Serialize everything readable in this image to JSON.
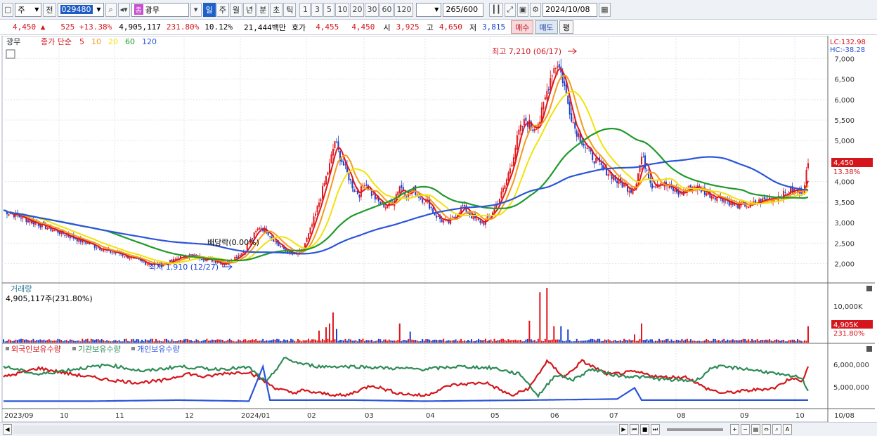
{
  "toolbar": {
    "market": "주",
    "prev": "전",
    "code": "029480",
    "badge": "종",
    "name": "광무",
    "periods": [
      "일",
      "주",
      "월",
      "년",
      "분",
      "초",
      "틱"
    ],
    "active_period": "일",
    "intervals": [
      "1",
      "3",
      "5",
      "10",
      "20",
      "30",
      "60",
      "120"
    ],
    "count": "265",
    "count_max": "/600",
    "date": "2024/10/08"
  },
  "quote": {
    "price": "4,450",
    "change_mark": "▲",
    "change": "525",
    "pct": "+13.38%",
    "volume": "4,905,117",
    "vol_ratio": "231.80%",
    "turnover": "10.12%",
    "amount": "21,444백만",
    "hoga_label": "호가",
    "bid": "4,455",
    "ask": "4,450",
    "open_label": "시",
    "open": "3,925",
    "high_label": "고",
    "high": "4,650",
    "low_label": "저",
    "low": "3,815",
    "buy": "매수",
    "sell": "매도",
    "eval": "평"
  },
  "legend": {
    "name": "광무",
    "ma_label": "종가 단순",
    "ma": [
      {
        "p": "5",
        "c": "#e0161c"
      },
      {
        "p": "10",
        "c": "#f59a1b"
      },
      {
        "p": "20",
        "c": "#f2e20a"
      },
      {
        "p": "60",
        "c": "#1e9a2a"
      },
      {
        "p": "120",
        "c": "#2a55d9"
      }
    ]
  },
  "lchc": {
    "lc": "LC:132.98",
    "hc": "HC:-38.28"
  },
  "annotations": {
    "high": "최고 7,210 (06/17)",
    "low": "최저 1,910 (12/27)",
    "dividend": "배당락(0.00%)"
  },
  "price_tag": {
    "value": "4,450",
    "pct": "13.38%"
  },
  "volume_panel": {
    "title": "거래량",
    "value": "4,905,117주(231.80%)",
    "axis": "10,000K",
    "tag": "4,905K",
    "tag_pct": "231.80%"
  },
  "holdings_panel": {
    "labels": [
      "외국인보유수량",
      "기관보유수량",
      "개인보유수량"
    ],
    "colors": [
      "#d4161c",
      "#2e8b57",
      "#2a55d9"
    ],
    "axis": [
      "6,000,000",
      "5,000,000"
    ]
  },
  "x_labels": [
    "2023/09",
    "10",
    "11",
    "12",
    "2024/01",
    "02",
    "03",
    "04",
    "05",
    "06",
    "07",
    "08",
    "09",
    "10",
    "10/08"
  ],
  "chart_data": {
    "type": "candlestick",
    "y_ticks": [
      7000,
      6500,
      6000,
      5500,
      5000,
      4500,
      4000,
      3500,
      3000,
      2500,
      2000
    ],
    "ylim": [
      1650,
      7450
    ],
    "high_point": {
      "value": 7210,
      "date": "06/17"
    },
    "low_point": {
      "value": 1910,
      "date": "12/27"
    },
    "last_close": 4450,
    "price_path": [
      [
        0,
        3300
      ],
      [
        6,
        3200
      ],
      [
        12,
        3100
      ],
      [
        18,
        3000
      ],
      [
        24,
        2900
      ],
      [
        30,
        2800
      ],
      [
        36,
        2700
      ],
      [
        42,
        2600
      ],
      [
        48,
        2500
      ],
      [
        54,
        2400
      ],
      [
        60,
        2300
      ],
      [
        66,
        2250
      ],
      [
        72,
        2150
      ],
      [
        78,
        2050
      ],
      [
        84,
        2000
      ],
      [
        90,
        1980
      ],
      [
        96,
        2050
      ],
      [
        100,
        2150
      ],
      [
        106,
        2200
      ],
      [
        112,
        2150
      ],
      [
        118,
        2100
      ],
      [
        122,
        2050
      ],
      [
        126,
        2000
      ],
      [
        132,
        2150
      ],
      [
        137,
        2300
      ],
      [
        140,
        2500
      ],
      [
        143,
        2700
      ],
      [
        146,
        2900
      ],
      [
        150,
        2800
      ],
      [
        154,
        2600
      ],
      [
        158,
        2400
      ],
      [
        162,
        2300
      ],
      [
        166,
        2200
      ],
      [
        170,
        2300
      ],
      [
        174,
        2700
      ],
      [
        178,
        3200
      ],
      [
        182,
        3800
      ],
      [
        186,
        4400
      ],
      [
        189,
        5000
      ],
      [
        192,
        4600
      ],
      [
        196,
        4200
      ],
      [
        200,
        3800
      ],
      [
        203,
        3700
      ],
      [
        206,
        4000
      ],
      [
        210,
        3700
      ],
      [
        214,
        3500
      ],
      [
        218,
        3400
      ],
      [
        222,
        3500
      ],
      [
        226,
        3900
      ],
      [
        230,
        3700
      ],
      [
        234,
        3800
      ],
      [
        238,
        3600
      ],
      [
        242,
        3500
      ],
      [
        246,
        3200
      ],
      [
        250,
        3050
      ],
      [
        254,
        3000
      ],
      [
        258,
        3200
      ],
      [
        262,
        3400
      ],
      [
        266,
        3200
      ],
      [
        270,
        3050
      ],
      [
        274,
        3000
      ],
      [
        278,
        3200
      ],
      [
        282,
        3500
      ],
      [
        286,
        3900
      ],
      [
        290,
        4500
      ],
      [
        294,
        5200
      ],
      [
        298,
        5500
      ],
      [
        302,
        5300
      ],
      [
        306,
        5500
      ],
      [
        310,
        6200
      ],
      [
        313,
        6700
      ],
      [
        316,
        6900
      ],
      [
        319,
        6500
      ],
      [
        322,
        5900
      ],
      [
        326,
        5300
      ],
      [
        330,
        5000
      ],
      [
        334,
        4700
      ],
      [
        338,
        4500
      ],
      [
        342,
        4300
      ],
      [
        346,
        4200
      ],
      [
        350,
        4000
      ],
      [
        354,
        3900
      ],
      [
        358,
        3800
      ],
      [
        361,
        4000
      ],
      [
        364,
        4600
      ],
      [
        367,
        4300
      ],
      [
        370,
        3900
      ],
      [
        374,
        4000
      ],
      [
        378,
        3900
      ],
      [
        382,
        3800
      ],
      [
        386,
        3700
      ],
      [
        390,
        3800
      ],
      [
        394,
        3900
      ],
      [
        398,
        3800
      ],
      [
        402,
        3700
      ],
      [
        406,
        3650
      ],
      [
        410,
        3600
      ],
      [
        414,
        3500
      ],
      [
        418,
        3400
      ],
      [
        422,
        3450
      ],
      [
        426,
        3400
      ],
      [
        430,
        3500
      ],
      [
        434,
        3550
      ],
      [
        438,
        3600
      ],
      [
        442,
        3650
      ],
      [
        446,
        3700
      ],
      [
        450,
        3800
      ],
      [
        453,
        3750
      ],
      [
        456,
        3800
      ],
      [
        459,
        4450
      ]
    ],
    "volume_spikes": [
      [
        180,
        22
      ],
      [
        184,
        28
      ],
      [
        186,
        35
      ],
      [
        188,
        55
      ],
      [
        190,
        25
      ],
      [
        226,
        35
      ],
      [
        232,
        20
      ],
      [
        300,
        40
      ],
      [
        306,
        92
      ],
      [
        310,
        100
      ],
      [
        314,
        30
      ],
      [
        318,
        30
      ],
      [
        322,
        24
      ],
      [
        360,
        15
      ],
      [
        364,
        35
      ],
      [
        459,
        30
      ]
    ],
    "holdings": {
      "foreign": [
        [
          0,
          0.55
        ],
        [
          20,
          0.72
        ],
        [
          40,
          0.6
        ],
        [
          60,
          0.5
        ],
        [
          75,
          0.45
        ],
        [
          90,
          0.48
        ],
        [
          105,
          0.62
        ],
        [
          115,
          0.55
        ],
        [
          125,
          0.62
        ],
        [
          140,
          0.65
        ],
        [
          155,
          0.35
        ],
        [
          165,
          0.25
        ],
        [
          170,
          0.3
        ],
        [
          180,
          0.25
        ],
        [
          195,
          0.2
        ],
        [
          210,
          0.4
        ],
        [
          225,
          0.25
        ],
        [
          240,
          0.2
        ],
        [
          255,
          0.4
        ],
        [
          275,
          0.45
        ],
        [
          290,
          0.2
        ],
        [
          300,
          0.35
        ],
        [
          310,
          0.85
        ],
        [
          320,
          0.55
        ],
        [
          330,
          0.85
        ],
        [
          345,
          0.6
        ],
        [
          360,
          0.65
        ],
        [
          375,
          0.55
        ],
        [
          390,
          0.55
        ],
        [
          400,
          0.35
        ],
        [
          410,
          0.25
        ],
        [
          425,
          0.3
        ],
        [
          440,
          0.35
        ],
        [
          450,
          0.55
        ],
        [
          455,
          0.45
        ],
        [
          459,
          0.75
        ]
      ],
      "institution": [
        [
          0,
          0.75
        ],
        [
          20,
          0.6
        ],
        [
          40,
          0.7
        ],
        [
          60,
          0.78
        ],
        [
          80,
          0.66
        ],
        [
          100,
          0.75
        ],
        [
          120,
          0.7
        ],
        [
          140,
          0.73
        ],
        [
          150,
          0.45
        ],
        [
          160,
          0.9
        ],
        [
          170,
          0.8
        ],
        [
          180,
          0.75
        ],
        [
          200,
          0.75
        ],
        [
          220,
          0.72
        ],
        [
          240,
          0.7
        ],
        [
          260,
          0.75
        ],
        [
          280,
          0.72
        ],
        [
          295,
          0.6
        ],
        [
          305,
          0.2
        ],
        [
          315,
          0.6
        ],
        [
          325,
          0.5
        ],
        [
          335,
          0.7
        ],
        [
          350,
          0.58
        ],
        [
          365,
          0.55
        ],
        [
          380,
          0.5
        ],
        [
          395,
          0.48
        ],
        [
          405,
          0.75
        ],
        [
          420,
          0.72
        ],
        [
          435,
          0.65
        ],
        [
          445,
          0.58
        ],
        [
          455,
          0.55
        ],
        [
          459,
          0.3
        ]
      ],
      "individual": [
        [
          0,
          0.1
        ],
        [
          50,
          0.1
        ],
        [
          100,
          0.12
        ],
        [
          140,
          0.1
        ],
        [
          148,
          0.75
        ],
        [
          152,
          0.12
        ],
        [
          200,
          0.12
        ],
        [
          240,
          0.1
        ],
        [
          300,
          0.12
        ],
        [
          350,
          0.14
        ],
        [
          360,
          0.35
        ],
        [
          364,
          0.12
        ],
        [
          400,
          0.12
        ],
        [
          459,
          0.12
        ]
      ]
    }
  }
}
